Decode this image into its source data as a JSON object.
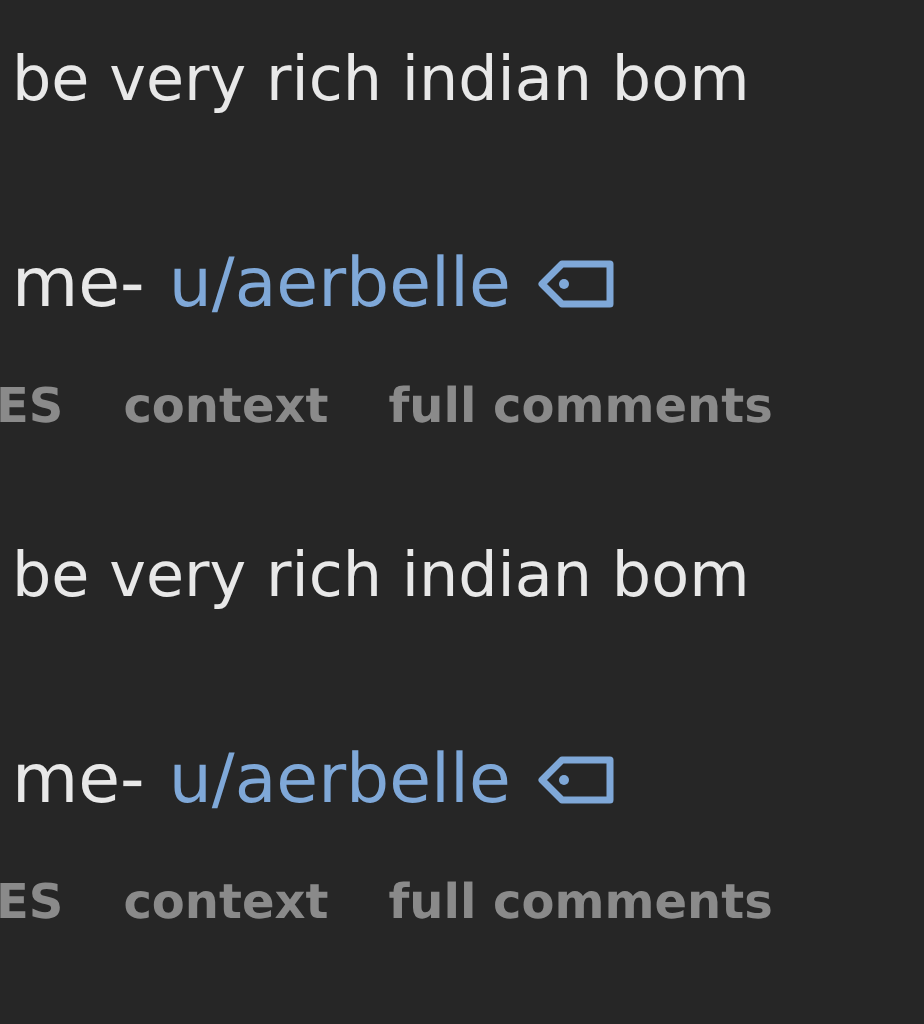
{
  "comments": [
    {
      "body": "be very rich indian bom",
      "byline": "me-",
      "author": "u/aerbelle",
      "actions": [
        "ES",
        "context",
        "full comments"
      ]
    },
    {
      "body": "be very rich indian bom",
      "byline": "me-",
      "author": "u/aerbelle",
      "actions": [
        "ES",
        "context",
        "full comments"
      ]
    }
  ]
}
